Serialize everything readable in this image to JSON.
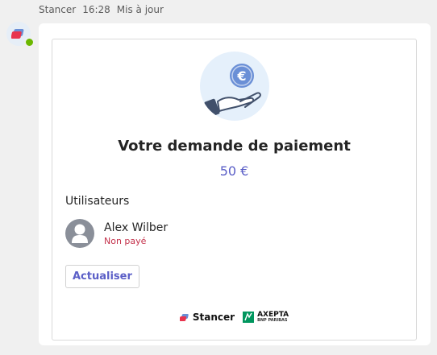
{
  "header": {
    "sender": "Stancer",
    "time": "16:28",
    "edited": "Mis à jour"
  },
  "card": {
    "hero_icon": "hand-holding-euro-icon",
    "title": "Votre demande de paiement",
    "amount": "50 €",
    "users_label": "Utilisateurs",
    "user": {
      "name": "Alex Wilber",
      "status": "Non payé"
    },
    "refresh_label": "Actualiser"
  },
  "footer": {
    "stancer_label": "Stancer",
    "axepta_label": "AXEPTA",
    "axepta_sub": "BNP PARIBAS"
  },
  "colors": {
    "accent": "#5b5fc7",
    "unpaid": "#c4314b",
    "hero_bg": "#e5f0fb",
    "euro_coin": "#6a8fd6"
  }
}
